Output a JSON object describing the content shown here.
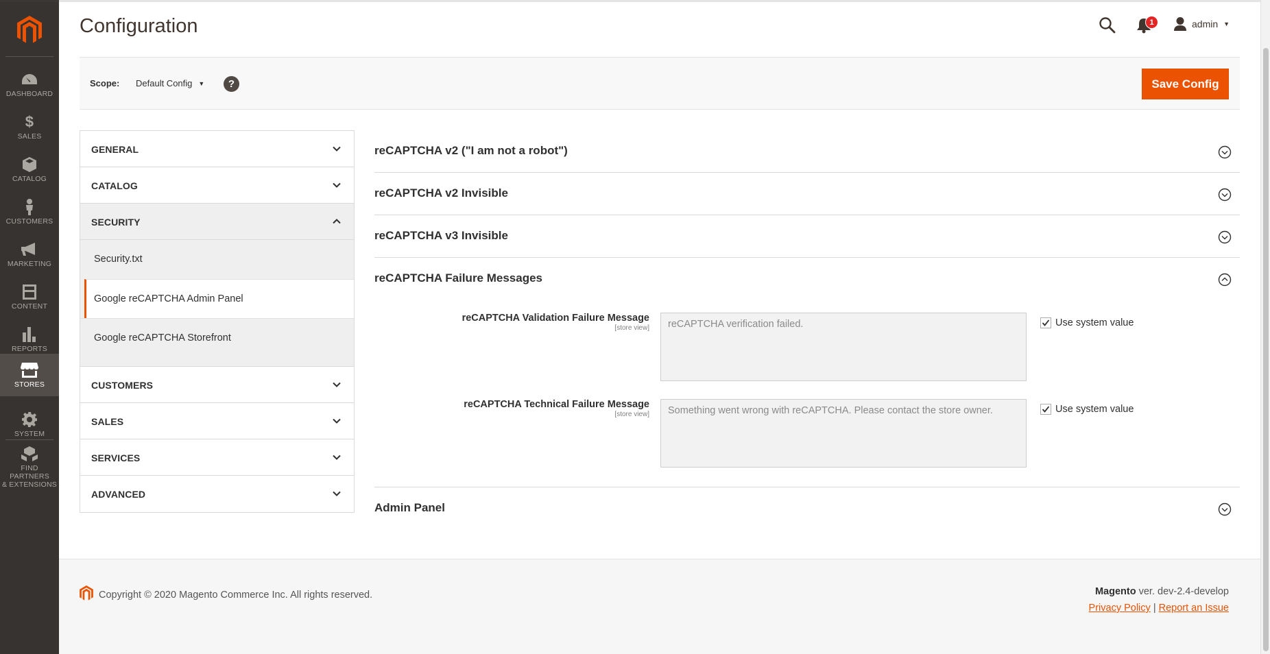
{
  "nav": {
    "items": [
      {
        "label": "DASHBOARD",
        "icon": "dashboard-icon"
      },
      {
        "label": "$",
        "icon": "dollar-icon",
        "sub": "SALES"
      },
      {
        "label": "CATALOG",
        "icon": "cube-icon"
      },
      {
        "label": "CUSTOMERS",
        "icon": "person-icon"
      },
      {
        "label": "MARKETING",
        "icon": "megaphone-icon"
      },
      {
        "label": "CONTENT",
        "icon": "content-icon"
      },
      {
        "label": "REPORTS",
        "icon": "bar-chart-icon"
      },
      {
        "label": "STORES",
        "icon": "store-icon"
      },
      {
        "label": "SYSTEM",
        "icon": "gear-icon"
      },
      {
        "label": "FIND PARTNERS",
        "label2": "& EXTENSIONS",
        "icon": "boxes-icon"
      }
    ],
    "sales_label": "SALES",
    "active": "STORES"
  },
  "header": {
    "title": "Configuration",
    "notifications_count": "1",
    "user": "admin"
  },
  "scope": {
    "label": "Scope:",
    "value": "Default Config",
    "help": "?",
    "save_label": "Save Config"
  },
  "tabs": {
    "general": "GENERAL",
    "catalog": "CATALOG",
    "security": "SECURITY",
    "security_items": [
      "Security.txt",
      "Google reCAPTCHA Admin Panel",
      "Google reCAPTCHA Storefront"
    ],
    "customers": "CUSTOMERS",
    "sales": "SALES",
    "services": "SERVICES",
    "advanced": "ADVANCED"
  },
  "sections": {
    "v2": "reCAPTCHA v2 (\"I am not a robot\")",
    "v2_invisible": "reCAPTCHA v2 Invisible",
    "v3_invisible": "reCAPTCHA v3 Invisible",
    "failure": "reCAPTCHA Failure Messages",
    "admin_panel": "Admin Panel"
  },
  "fields": {
    "validation": {
      "label": "reCAPTCHA Validation Failure Message",
      "scope": "[store view]",
      "value": "reCAPTCHA verification failed.",
      "system": "Use system value"
    },
    "technical": {
      "label": "reCAPTCHA Technical Failure Message",
      "scope": "[store view]",
      "value": "Something went wrong with reCAPTCHA. Please contact the store owner.",
      "system": "Use system value"
    }
  },
  "footer": {
    "copyright": "Copyright © 2020 Magento Commerce Inc. All rights reserved.",
    "brand": "Magento",
    "version": " ver. dev-2.4-develop",
    "privacy": "Privacy Policy",
    "sep": "|",
    "report": "Report an Issue"
  },
  "colors": {
    "accent": "#eb5202",
    "nav_bg": "#373330",
    "nav_active": "#524d49"
  }
}
